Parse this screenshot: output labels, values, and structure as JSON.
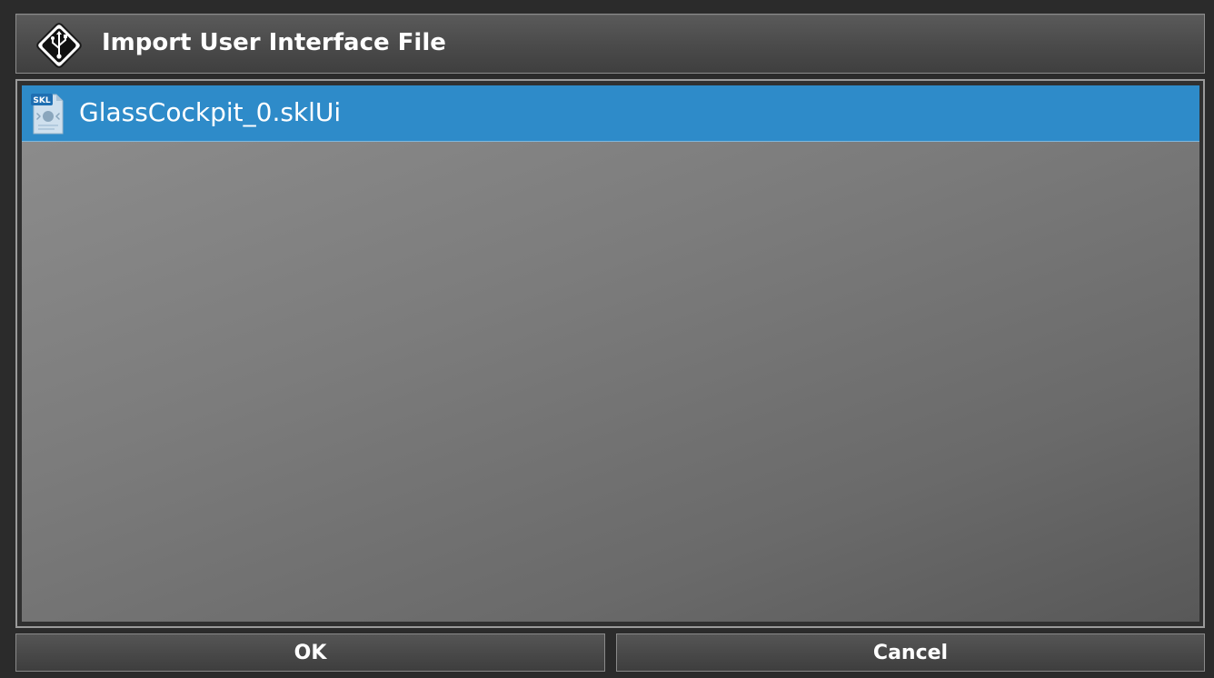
{
  "dialog": {
    "title": "Import User Interface File",
    "title_icon": "usb-icon"
  },
  "file_list": {
    "items": [
      {
        "name": "GlassCockpit_0.sklUi",
        "icon": "skl-file-icon",
        "icon_label": "SKL",
        "selected": true
      }
    ]
  },
  "buttons": {
    "ok_label": "OK",
    "cancel_label": "Cancel"
  },
  "colors": {
    "selection": "#2e8bc9",
    "background": "#2b2b2b",
    "text": "#ffffff"
  }
}
